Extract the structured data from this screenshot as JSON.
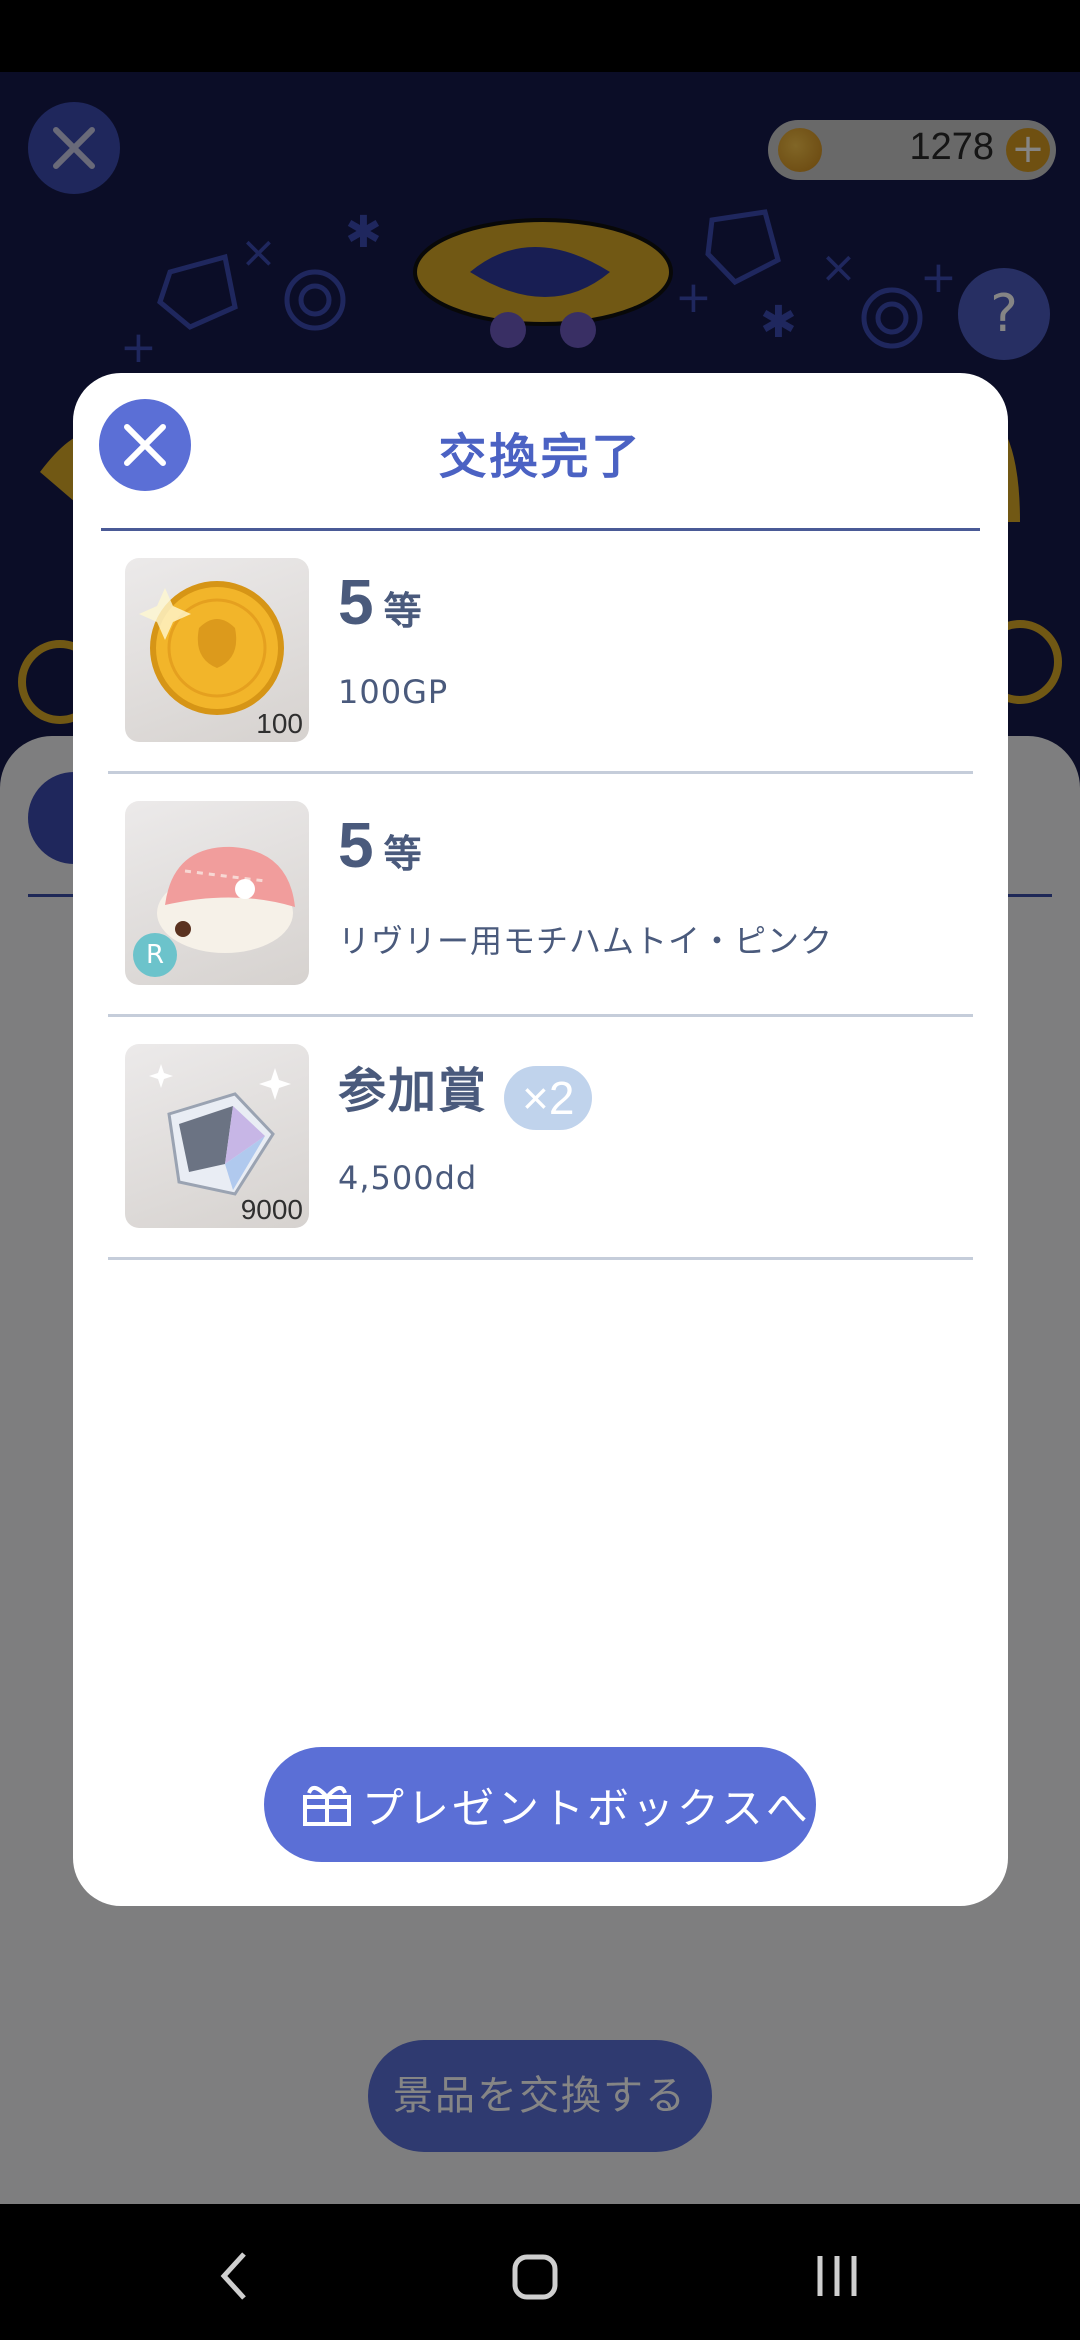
{
  "header": {
    "coin_balance": "1278",
    "plus_symbol": "+",
    "help_symbol": "?"
  },
  "background": {
    "exchange_button_label": "景品を交換する"
  },
  "modal": {
    "title": "交換完了",
    "prizes": [
      {
        "rank_number": "5",
        "rank_suffix": "等",
        "description": "100GP",
        "thumb_quantity": "100",
        "icon": "gold-coin-icon"
      },
      {
        "rank_number": "5",
        "rank_suffix": "等",
        "description": "リヴリー用モチハムトイ・ピンク",
        "rarity_badge": "R",
        "icon": "hamster-toy-icon"
      },
      {
        "rank_text": "参加賞",
        "multiplier": "×2",
        "description": "4,500dd",
        "thumb_quantity": "9000",
        "icon": "diamond-icon"
      }
    ],
    "present_button_label": "プレゼントボックスへ"
  },
  "colors": {
    "accent": "#5b6fd6",
    "title": "#4b62c3",
    "text": "#4a5a7c",
    "background": "#161a4b"
  }
}
